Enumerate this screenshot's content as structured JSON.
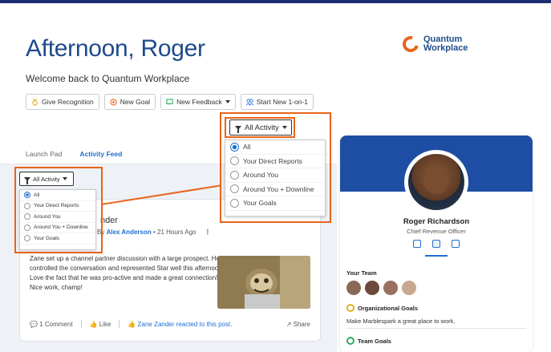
{
  "header": {
    "greeting": "Afternoon, Roger",
    "welcome": "Welcome back to Quantum Workplace",
    "logo_line1": "Quantum",
    "logo_line2": "Workplace"
  },
  "actions": [
    {
      "label": "Give Recognition",
      "icon": "medal-icon"
    },
    {
      "label": "New Goal",
      "icon": "target-icon"
    },
    {
      "label": "New Feedback",
      "icon": "feedback-icon"
    },
    {
      "label": "Start New 1-on-1",
      "icon": "people-icon"
    }
  ],
  "tabs": [
    {
      "label": "Launch Pad",
      "active": false
    },
    {
      "label": "Activity Feed",
      "active": true
    }
  ],
  "filter": {
    "label": "All Activity",
    "options": [
      "All",
      "Your Direct Reports",
      "Around You",
      "Around You + Downline",
      "Your Goals"
    ],
    "selected": "All"
  },
  "feed": {
    "name_partial": "nder",
    "meta_prefix": "By",
    "author": "Alex Anderson",
    "time": "• 21 Hours Ago",
    "body": "Zane set up a channel partner discussion with a large prospect. He controlled the conversation and represented Star well this afternoon. Love the fact that he was pro-active and made a great connection! Nice work, champ!",
    "comments": "1 Comment",
    "like": "Like",
    "reaction": "Zane Zander reacted to this post.",
    "share": "Share"
  },
  "profile": {
    "name": "Roger Richardson",
    "title": "Chief Revenue Officer",
    "team_label": "Your Team",
    "org_goals_label": "Organizational Goals",
    "org_goal_text": "Make Marblespark a great place to work.",
    "team_goals_label": "Team Goals"
  },
  "colors": {
    "accent": "#1f6fd1",
    "brand_blue": "#1f4a8c",
    "highlight": "#e8641b"
  }
}
